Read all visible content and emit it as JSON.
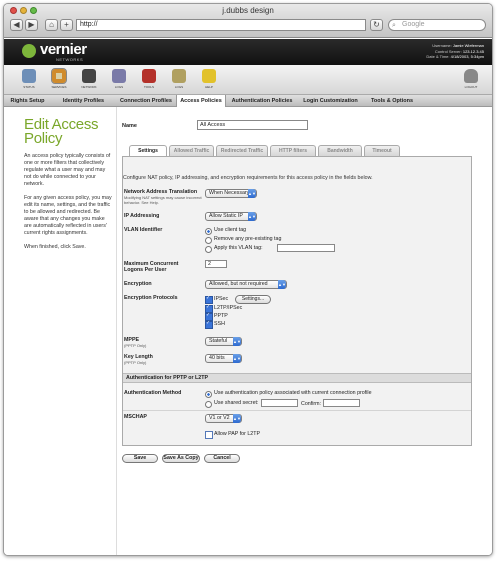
{
  "window": {
    "title": "j.dubbs design",
    "url": "http://",
    "search_placeholder": "Google"
  },
  "brand": {
    "name": "vernier",
    "sub": "NETWORKS"
  },
  "userinfo": {
    "username_label": "Username:",
    "username": "Jamie Wieferman",
    "server_label": "Control Server:",
    "server": "123.12.3.45",
    "date_label": "Date & Time:",
    "date": "4/18/2003, 5:34pm"
  },
  "icons": [
    {
      "label": "STATUS",
      "name": "status-icon",
      "color": "#6e8fb8"
    },
    {
      "label": "SERVICES",
      "name": "services-icon",
      "color": "#d08b2c"
    },
    {
      "label": "NETWORK",
      "name": "network-icon",
      "color": "#444444"
    },
    {
      "label": "LOGS",
      "name": "logs-icon",
      "color": "#7a7aa8"
    },
    {
      "label": "TOOLS",
      "name": "tools-icon",
      "color": "#b4312a"
    },
    {
      "label": "LOGS",
      "name": "logs-2-icon",
      "color": "#b0a060"
    },
    {
      "label": "HELP",
      "name": "help-icon",
      "color": "#e2c22b"
    }
  ],
  "logout_label": "LOGOUT",
  "nav": [
    "Rights Setup",
    "Identity Profiles",
    "Connection Profiles",
    "Access Policies",
    "Authentication Policies",
    "Login Customization",
    "Tools & Options"
  ],
  "page": {
    "title": "Edit Access Policy",
    "help": [
      "An access policy typically consists of one or more filters that collectively regulate what a user may and may not do while connected to your network.",
      "For any given access policy, you may edit its name, settings, and the traffic to be allowed and redirected. Be aware that any changes you make are automatically reflected in users' current rights assignments.",
      "When finished, click Save."
    ]
  },
  "form": {
    "name_label": "Name",
    "name_value": "All Access",
    "subtabs": [
      "Settings",
      "Allowed Traffic",
      "Redirected Traffic",
      "HTTP filters",
      "Bandwidth",
      "Timeout"
    ],
    "intro": "Configure NAT policy, IP addressing, and encryption requirements for this access policy in the fields below.",
    "nat_label": "Network Address Translation",
    "nat_help": "Modifying NAT settings may cause incorrect behavior. See Help.",
    "nat_value": "When Necessary",
    "ip_label": "IP Addressing",
    "ip_value": "Allow Static IP",
    "vlan_label": "VLAN Identifier",
    "vlan_opt1": "Use client tag",
    "vlan_opt2": "Remove any pre-existing tag",
    "vlan_opt3": "Apply this VLAN tag:",
    "logons_label": "Maximum Concurrent Logons Per User",
    "logons_value": "2",
    "enc_label": "Encryption",
    "enc_value": "Allowed, but not required",
    "protocols_label": "Encryption Protocols",
    "protocols": [
      "IPSec",
      "L2TP/IPSec",
      "PPTP",
      "SSH"
    ],
    "settings_button": "Settings...",
    "mppe_label": "MPPE",
    "mppe_sub": "(PPTP Only)",
    "mppe_value": "Stateful",
    "keylen_label": "Key Length",
    "keylen_sub": "(PPTP Only)",
    "keylen_value": "40 bits",
    "auth_section": "Authentication for PPTP or L2TP",
    "auth_label": "Authentication Method",
    "auth_opt1": "Use authentication policy associated with current connection profile",
    "auth_opt2": "Use shared secret:",
    "confirm_label": "Confirm:",
    "mschap_label": "MSCHAP",
    "mschap_value": "V1 or V2",
    "allow_pap": "Allow PAP for L2TP"
  },
  "buttons": {
    "save": "Save",
    "save_as_copy": "Save As Copy",
    "cancel": "Cancel"
  }
}
